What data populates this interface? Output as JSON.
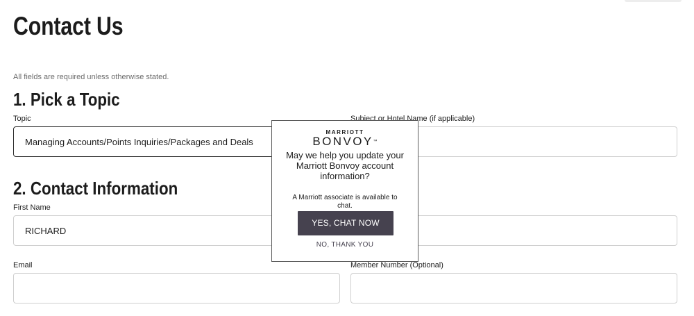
{
  "page": {
    "title": "Contact Us",
    "required_note": "All fields are required unless otherwise stated."
  },
  "topic_section": {
    "heading": "1. Pick a Topic",
    "topic_label": "Topic",
    "topic_value": "Managing Accounts/Points Inquiries/Packages and Deals",
    "subject_label": "Subject or Hotel Name (if applicable)",
    "subject_value": ""
  },
  "contact_section": {
    "heading": "2. Contact Information",
    "first_name_label": "First Name",
    "first_name_value": "RICHARD",
    "last_name_value": "",
    "email_label": "Email",
    "email_value": "",
    "member_number_label": "Member Number (Optional)",
    "member_number_value": ""
  },
  "chat_modal": {
    "brand_small": "MARRIOTT",
    "brand_big": "BONVOY",
    "brand_tm": "™",
    "question": "May we help you update your Marriott Bonvoy account information?",
    "note": "A Marriott associate is available to chat.",
    "accept_label": "YES, CHAT NOW",
    "decline_label": "NO, THANK YOU"
  },
  "colors": {
    "button_bg": "#46424f",
    "text": "#1c1c1c",
    "muted_text": "#6b6b6b",
    "input_border": "#cfcfcf"
  }
}
